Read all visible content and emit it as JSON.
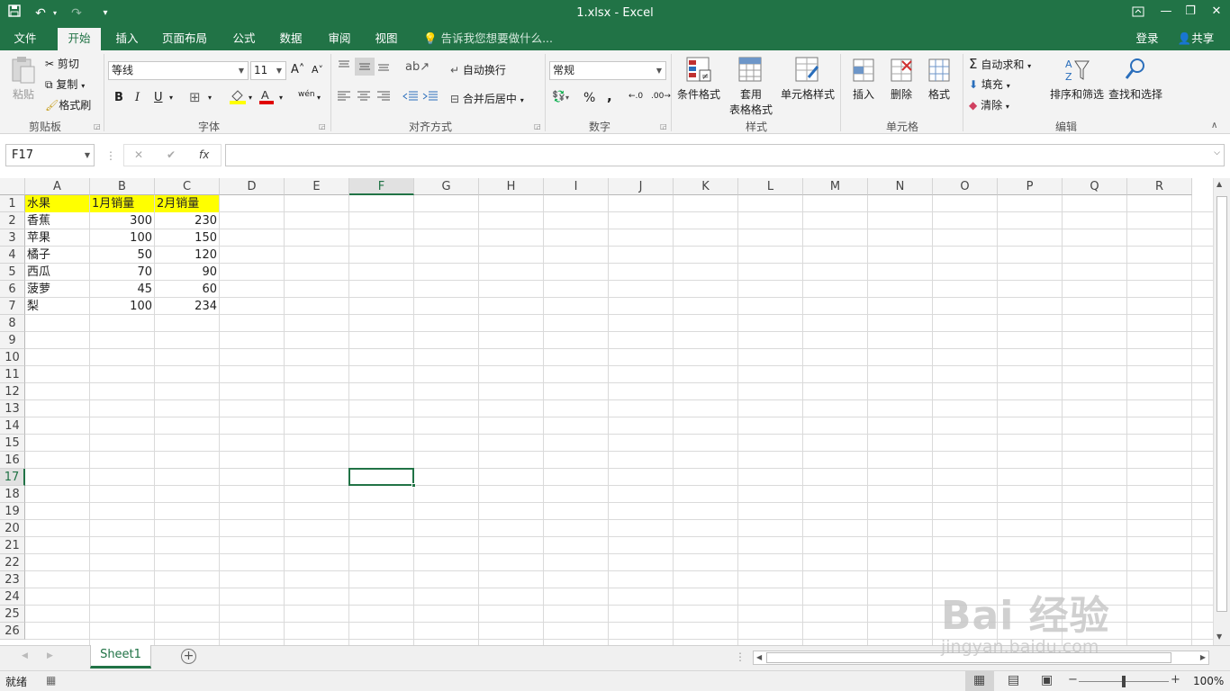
{
  "window": {
    "title": "1.xlsx - Excel"
  },
  "qat": {
    "save": "▣",
    "undo": "↶",
    "redo": "↷",
    "customize": "▾"
  },
  "window_buttons": {
    "ribbon_options": "⬚",
    "minimize": "—",
    "restore": "❐",
    "close": "✕"
  },
  "tabs": [
    {
      "label": "文件"
    },
    {
      "label": "开始"
    },
    {
      "label": "插入"
    },
    {
      "label": "页面布局"
    },
    {
      "label": "公式"
    },
    {
      "label": "数据"
    },
    {
      "label": "审阅"
    },
    {
      "label": "视图"
    }
  ],
  "tell_me": "告诉我您想要做什么...",
  "account": {
    "signin": "登录",
    "share": "共享"
  },
  "ribbon": {
    "clipboard": {
      "label": "剪贴板",
      "paste": "粘贴",
      "cut": "剪切",
      "copy": "复制",
      "format_painter": "格式刷"
    },
    "font": {
      "label": "字体",
      "font_name": "等线",
      "font_size": "11",
      "bold": "B",
      "italic": "I",
      "underline": "U",
      "grow": "A˄",
      "shrink": "A˅",
      "phonetic": "wén"
    },
    "alignment": {
      "label": "对齐方式",
      "wrap_text": "自动换行",
      "merge_center": "合并后居中"
    },
    "number": {
      "label": "数字",
      "format": "常规",
      "percent": "%",
      "comma": ","
    },
    "styles": {
      "label": "样式",
      "conditional": "条件格式",
      "format_table_1": "套用",
      "format_table_2": "表格格式",
      "cell_styles": "单元格样式"
    },
    "cells": {
      "label": "单元格",
      "insert": "插入",
      "delete": "删除",
      "format": "格式"
    },
    "editing": {
      "label": "编辑",
      "autosum": "自动求和",
      "fill": "填充",
      "clear": "清除",
      "sort_filter": "排序和筛选",
      "find_select": "查找和选择"
    }
  },
  "formula_bar": {
    "name_box": "F17",
    "cancel": "✕",
    "enter": "✔",
    "fx": "fx",
    "formula": ""
  },
  "columns": [
    "A",
    "B",
    "C",
    "D",
    "E",
    "F",
    "G",
    "H",
    "I",
    "J",
    "K",
    "L",
    "M",
    "N",
    "O",
    "P",
    "Q",
    "R"
  ],
  "rows": [
    "1",
    "2",
    "3",
    "4",
    "5",
    "6",
    "7",
    "8",
    "9",
    "10",
    "11",
    "12",
    "13",
    "14",
    "15",
    "16",
    "17",
    "18",
    "19",
    "20",
    "21",
    "22",
    "23",
    "24",
    "25",
    "26"
  ],
  "cells": {
    "header": [
      "水果",
      "1月销量",
      "2月销量"
    ],
    "data": [
      [
        "香蕉",
        "300",
        "230"
      ],
      [
        "苹果",
        "100",
        "150"
      ],
      [
        "橘子",
        "50",
        "120"
      ],
      [
        "西瓜",
        "70",
        "90"
      ],
      [
        "菠萝",
        "45",
        "60"
      ],
      [
        "梨",
        "100",
        "234"
      ]
    ]
  },
  "selected_cell": "F17",
  "sheet_tabs": [
    {
      "label": "Sheet1"
    }
  ],
  "status": {
    "ready": "就绪",
    "zoom": "100%"
  },
  "watermark": {
    "brand": "Bai  经验",
    "url": "jingyan.baidu.com"
  },
  "colors": {
    "excel_green": "#217346",
    "header_fill": "#ffff00",
    "selection_border": "#217346"
  }
}
